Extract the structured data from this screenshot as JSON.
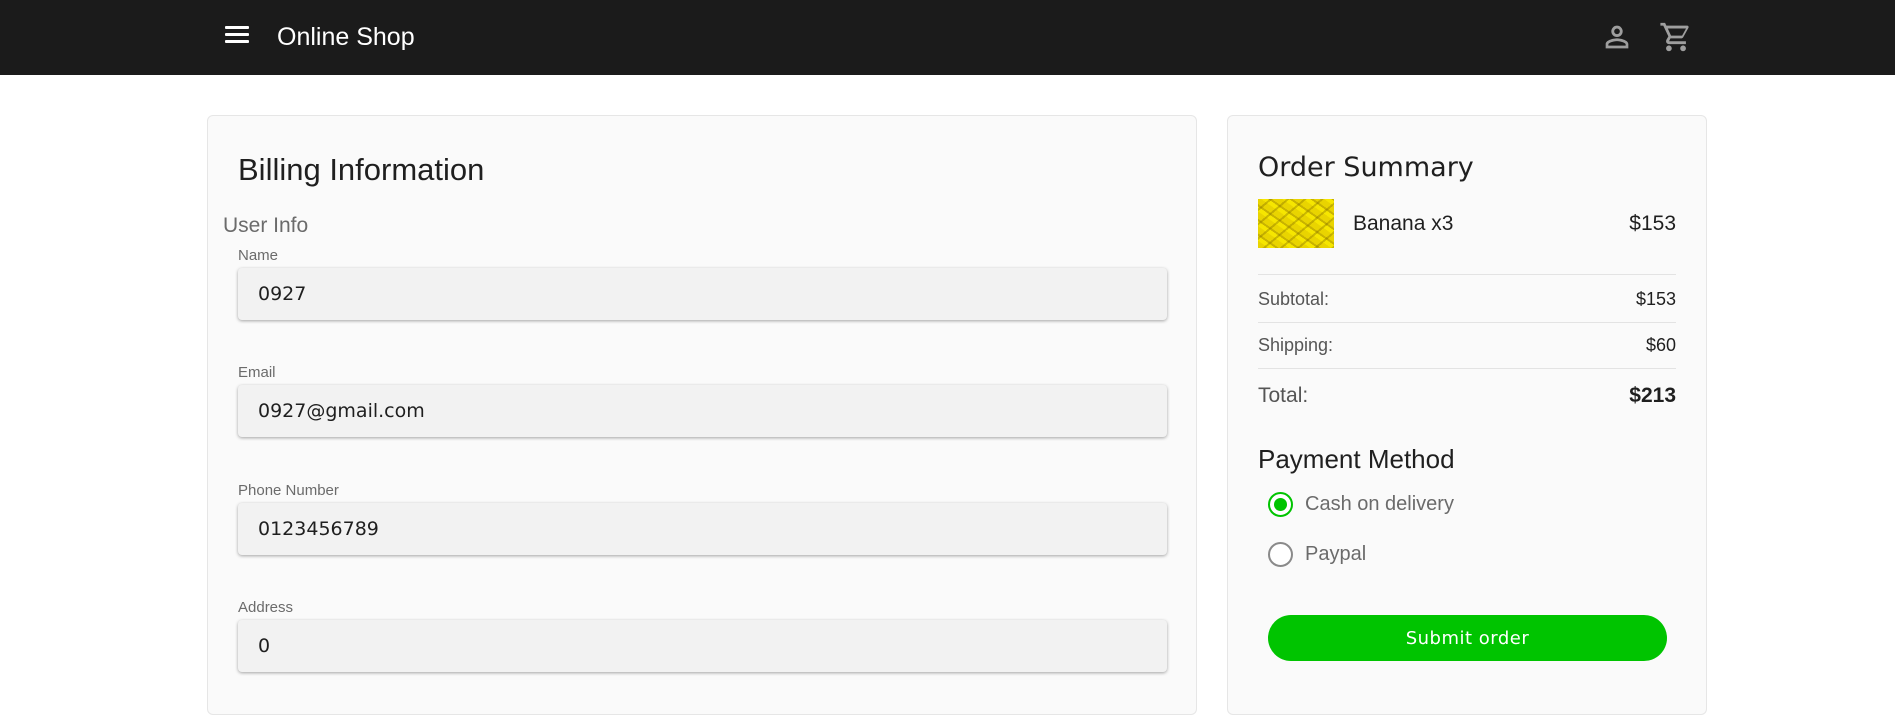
{
  "header": {
    "menu_icon": "menu-icon",
    "title": "Online Shop",
    "account_icon": "account-icon",
    "cart_icon": "cart-icon"
  },
  "billing": {
    "title": "Billing Information",
    "section": "User Info",
    "fields": [
      {
        "label": "Name",
        "value": "0927"
      },
      {
        "label": "Email",
        "value": "0927@gmail.com"
      },
      {
        "label": "Phone Number",
        "value": "0123456789"
      },
      {
        "label": "Address",
        "value": "0"
      }
    ]
  },
  "summary": {
    "title": "Order Summary",
    "item": {
      "name": "Banana x3",
      "price": "$153",
      "image": "banana-image"
    },
    "subtotal": {
      "label": "Subtotal:",
      "value": "$153"
    },
    "shipping": {
      "label": "Shipping:",
      "value": "$60"
    },
    "total": {
      "label": "Total:",
      "value": "$213"
    }
  },
  "payment": {
    "title": "Payment Method",
    "options": [
      {
        "label": "Cash on delivery",
        "selected": true
      },
      {
        "label": "Paypal",
        "selected": false
      }
    ],
    "submit_label": "Submit order"
  },
  "colors": {
    "header_bg": "#1b1b1b",
    "accent": "#00c400",
    "card_bg": "#fafafa"
  }
}
